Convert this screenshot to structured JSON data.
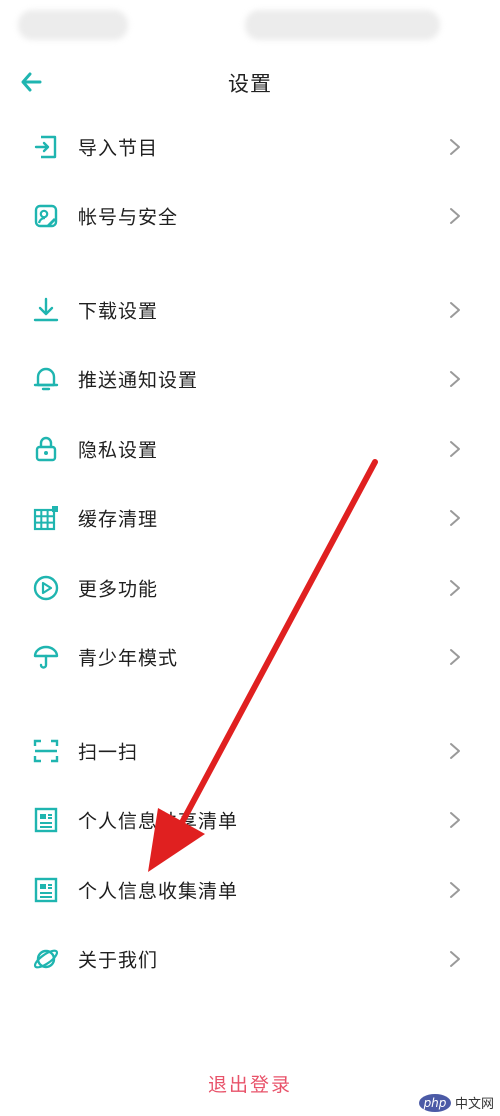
{
  "header": {
    "title": "设置"
  },
  "menu_groups": [
    [
      {
        "label": "导入节目",
        "icon": "import-icon"
      },
      {
        "label": "帐号与安全",
        "icon": "account-security-icon"
      }
    ],
    [
      {
        "label": "下载设置",
        "icon": "download-icon"
      },
      {
        "label": "推送通知设置",
        "icon": "bell-icon"
      },
      {
        "label": "隐私设置",
        "icon": "lock-icon"
      },
      {
        "label": "缓存清理",
        "icon": "grid-cache-icon"
      },
      {
        "label": "更多功能",
        "icon": "play-circle-icon"
      },
      {
        "label": "青少年模式",
        "icon": "umbrella-icon"
      }
    ],
    [
      {
        "label": "扫一扫",
        "icon": "scan-icon"
      },
      {
        "label": "个人信息共享清单",
        "icon": "document-list-icon"
      },
      {
        "label": "个人信息收集清单",
        "icon": "document-list-icon"
      },
      {
        "label": "关于我们",
        "icon": "planet-icon"
      }
    ]
  ],
  "logout_label": "退出登录",
  "watermark": {
    "badge": "php",
    "text": "中文网"
  },
  "colors": {
    "accent": "#1fb5b0",
    "logout": "#e8536a",
    "arrow": "#e02020",
    "chevron": "#9a9a9a"
  }
}
